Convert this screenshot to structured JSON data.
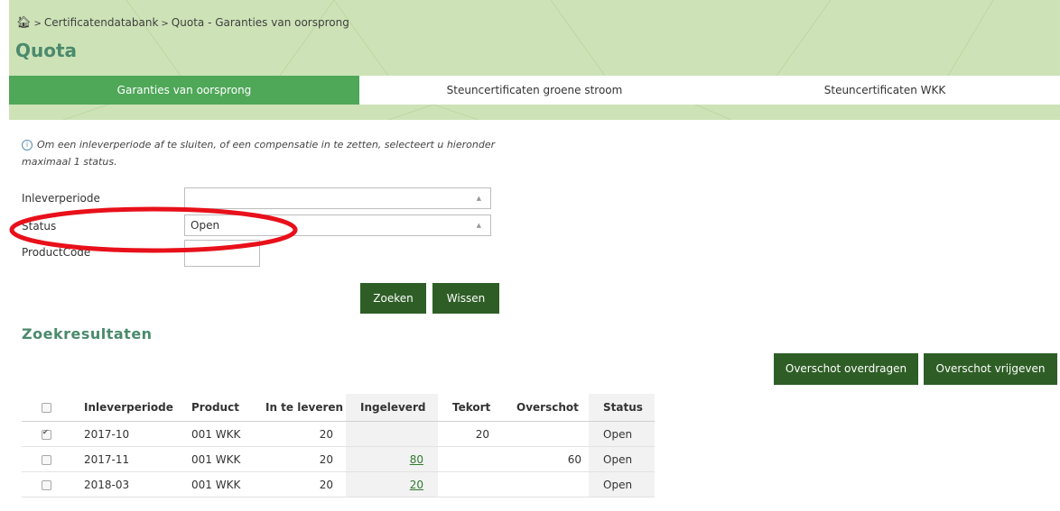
{
  "breadcrumb": {
    "items": [
      "Certificatendatabank",
      "Quota - Garanties van oorsprong"
    ],
    "separator": ">"
  },
  "page": {
    "title": "Quota"
  },
  "tabs": [
    {
      "label": "Garanties van oorsprong",
      "active": true
    },
    {
      "label": "Steuncertificaten groene stroom",
      "active": false
    },
    {
      "label": "Steuncertificaten WKK",
      "active": false
    }
  ],
  "info": {
    "text": "Om een inleverperiode af te sluiten, of een compensatie in te zetten, selecteert u hieronder maximaal 1 status."
  },
  "form": {
    "inleverperiode": {
      "label": "Inleverperiode",
      "value": ""
    },
    "status": {
      "label": "Status",
      "value": "Open"
    },
    "productcode": {
      "label": "ProductCode",
      "value": ""
    },
    "search_label": "Zoeken",
    "clear_label": "Wissen"
  },
  "results": {
    "title": "Zoekresultaten",
    "transfer_label": "Overschot overdragen",
    "release_label": "Overschot vrijgeven",
    "columns": [
      "Inleverperiode",
      "Product",
      "In te leveren",
      "Ingeleverd",
      "Tekort",
      "Overschot",
      "Status"
    ],
    "rows": [
      {
        "checked": true,
        "inleverperiode": "2017-10",
        "product": "001 WKK",
        "in_te_leveren": "20",
        "ingeleverd": "",
        "tekort": "20",
        "overschot": "",
        "status": "Open"
      },
      {
        "checked": false,
        "inleverperiode": "2017-11",
        "product": "001 WKK",
        "in_te_leveren": "20",
        "ingeleverd": "80",
        "tekort": "",
        "overschot": "60",
        "status": "Open"
      },
      {
        "checked": false,
        "inleverperiode": "2018-03",
        "product": "001 WKK",
        "in_te_leveren": "20",
        "ingeleverd": "20",
        "tekort": "",
        "overschot": "",
        "status": "Open"
      }
    ]
  },
  "colors": {
    "header_bg": "#cde3b7",
    "tab_active": "#4fa758",
    "button": "#2e5e26",
    "title": "#4b8a6c",
    "highlight": "#e8101a"
  }
}
